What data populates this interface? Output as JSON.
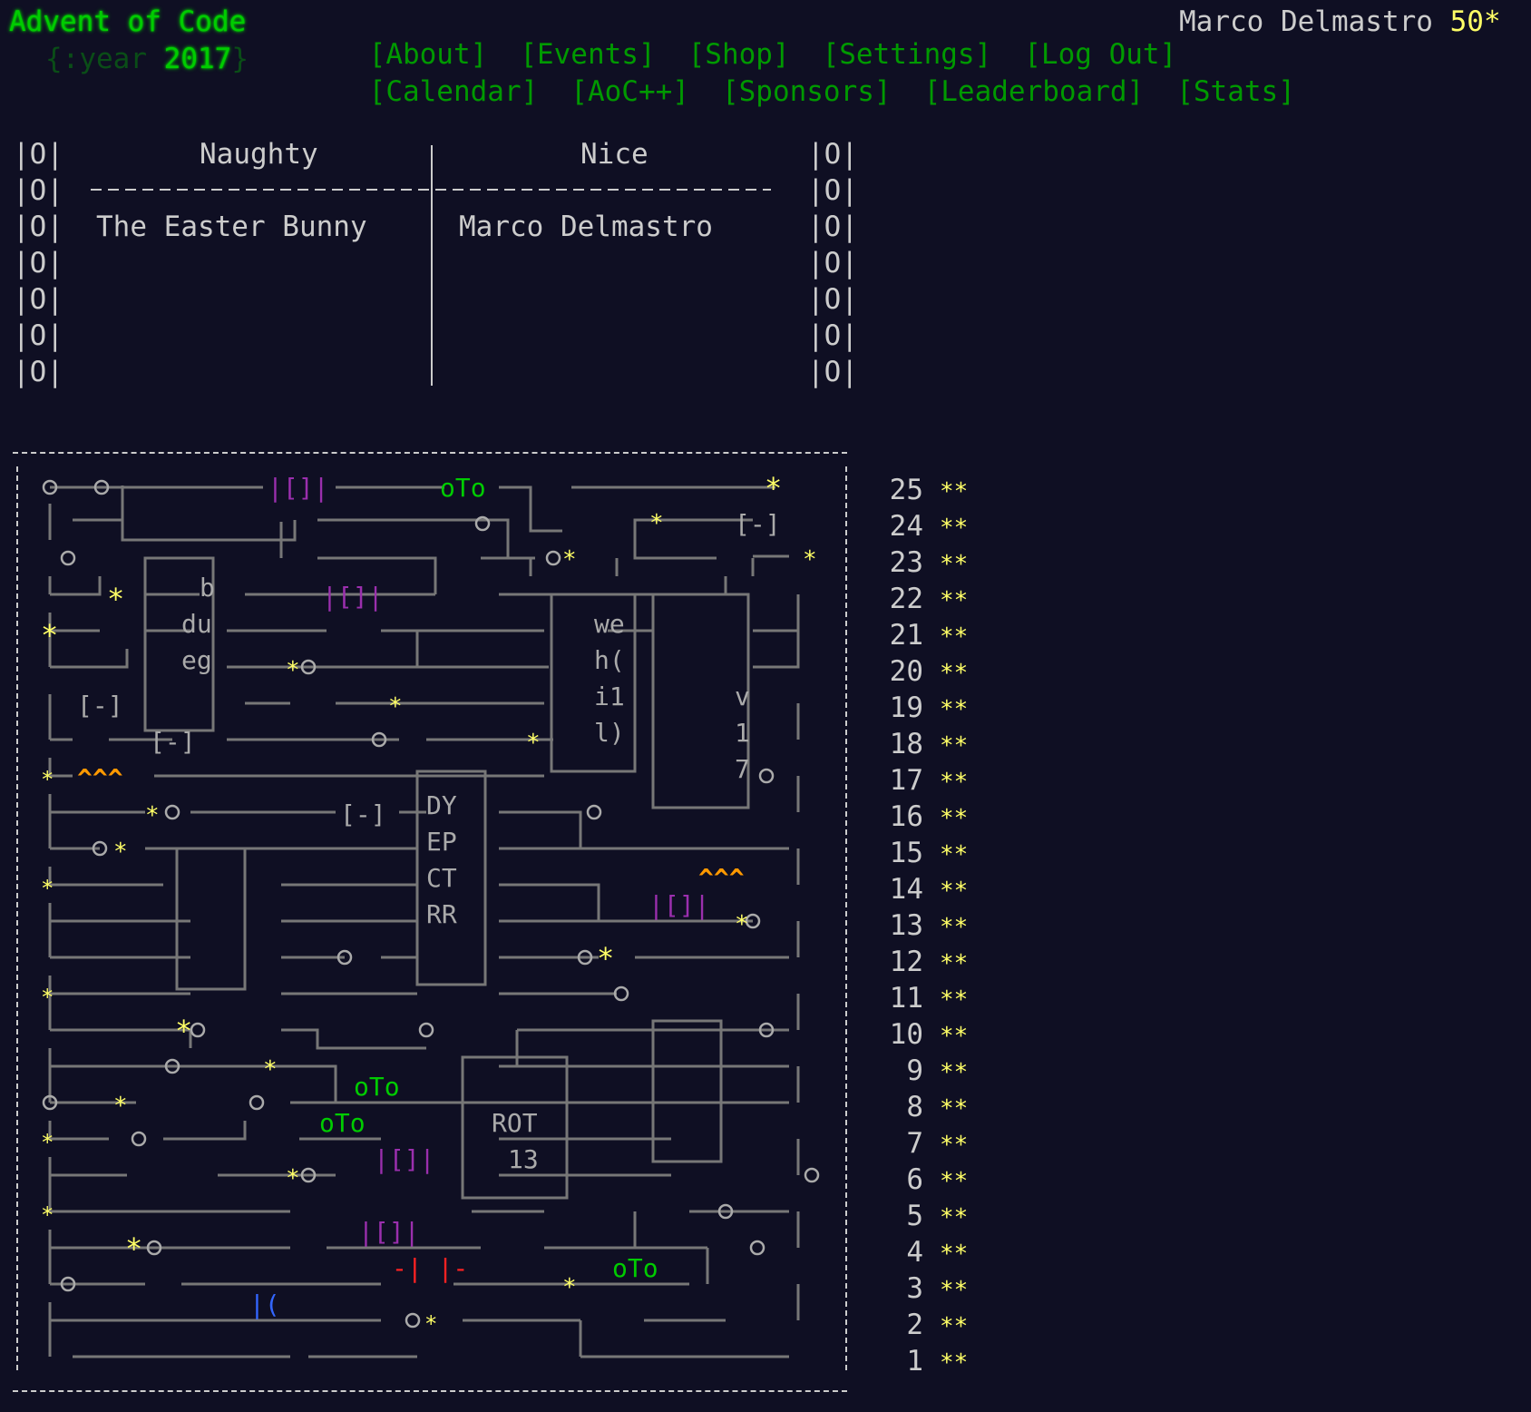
{
  "header": {
    "site_title": "Advent of Code",
    "year_prefix": "{:year ",
    "year": "2017",
    "year_suffix": "}",
    "nav_row1": [
      "[About]",
      "[Events]",
      "[Shop]",
      "[Settings]",
      "[Log Out]"
    ],
    "nav_row2": [
      "[Calendar]",
      "[AoC++]",
      "[Sponsors]",
      "[Leaderboard]",
      "[Stats]"
    ],
    "user_name": "Marco Delmastro",
    "user_stars": "50*"
  },
  "naughty_nice": {
    "col_naughty": "Naughty",
    "col_nice": "Nice",
    "naughty_name": "The Easter Bunny",
    "nice_name": "Marco Delmastro"
  },
  "calendar": {
    "labels": {
      "oTo": "oTo",
      "chip_b_du_eg": [
        "b",
        "du",
        "eg"
      ],
      "chip_we": [
        "we",
        "h(",
        "i1",
        "l)"
      ],
      "chip_v17": [
        "v",
        "1",
        "7"
      ],
      "chip_dyep": [
        "DY",
        "EP",
        "CT",
        "RR"
      ],
      "chip_rot13": [
        "ROT",
        "13"
      ],
      "caret3": "^^^",
      "resistor": "[-]",
      "cap": "|[]|"
    },
    "days": [
      {
        "day": "25",
        "stars": "**"
      },
      {
        "day": "24",
        "stars": "**"
      },
      {
        "day": "23",
        "stars": "**"
      },
      {
        "day": "22",
        "stars": "**"
      },
      {
        "day": "21",
        "stars": "**"
      },
      {
        "day": "20",
        "stars": "**"
      },
      {
        "day": "19",
        "stars": "**"
      },
      {
        "day": "18",
        "stars": "**"
      },
      {
        "day": "17",
        "stars": "**"
      },
      {
        "day": "16",
        "stars": "**"
      },
      {
        "day": "15",
        "stars": "**"
      },
      {
        "day": "14",
        "stars": "**"
      },
      {
        "day": "13",
        "stars": "**"
      },
      {
        "day": "12",
        "stars": "**"
      },
      {
        "day": "11",
        "stars": "**"
      },
      {
        "day": "10",
        "stars": "**"
      },
      {
        "day": "9",
        "stars": "**"
      },
      {
        "day": "8",
        "stars": "**"
      },
      {
        "day": "7",
        "stars": "**"
      },
      {
        "day": "6",
        "stars": "**"
      },
      {
        "day": "5",
        "stars": "**"
      },
      {
        "day": "4",
        "stars": "**"
      },
      {
        "day": "3",
        "stars": "**"
      },
      {
        "day": "2",
        "stars": "**"
      },
      {
        "day": "1",
        "stars": "**"
      }
    ]
  }
}
